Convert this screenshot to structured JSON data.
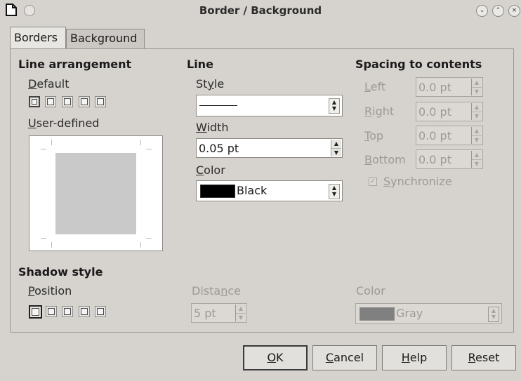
{
  "window": {
    "title": "Border / Background",
    "buttons": {
      "minimize": "⌄",
      "maximize": "⌃",
      "close": "×"
    }
  },
  "tabs": [
    {
      "label": "Borders",
      "active": true
    },
    {
      "label": "Background",
      "active": false
    }
  ],
  "line_arrangement": {
    "heading": "Line arrangement",
    "default_label": "Default",
    "default_mnemonic": "D",
    "default_rest": "efault",
    "user_defined_label": "User-defined",
    "user_defined_mnemonic": "U",
    "user_defined_rest": "ser-defined"
  },
  "line": {
    "heading": "Line",
    "style_label": "Style",
    "style_mnemonic": "y",
    "width_label": "Width",
    "width_value": "0.05 pt",
    "color_label": "Color",
    "color_value": "Black",
    "color_hex": "#000000"
  },
  "spacing": {
    "heading": "Spacing to contents",
    "left_label": "Left",
    "left_value": "0.0 pt",
    "right_label": "Right",
    "right_value": "0.0 pt",
    "top_label": "Top",
    "top_value": "0.0 pt",
    "bottom_label": "Bottom",
    "bottom_value": "0.0 pt",
    "synchronize_label": "Synchronize",
    "synchronize_checked": true
  },
  "shadow": {
    "heading": "Shadow style",
    "position_label": "Position",
    "distance_label": "Distance",
    "distance_value": "5 pt",
    "color_label": "Color",
    "color_value": "Gray",
    "color_hex": "#808080"
  },
  "footer": {
    "ok": "OK",
    "cancel": "Cancel",
    "help": "Help",
    "reset": "Reset"
  },
  "colors": {
    "dialog_bg": "#d6d3ce",
    "disabled_text": "#9d9a95"
  }
}
